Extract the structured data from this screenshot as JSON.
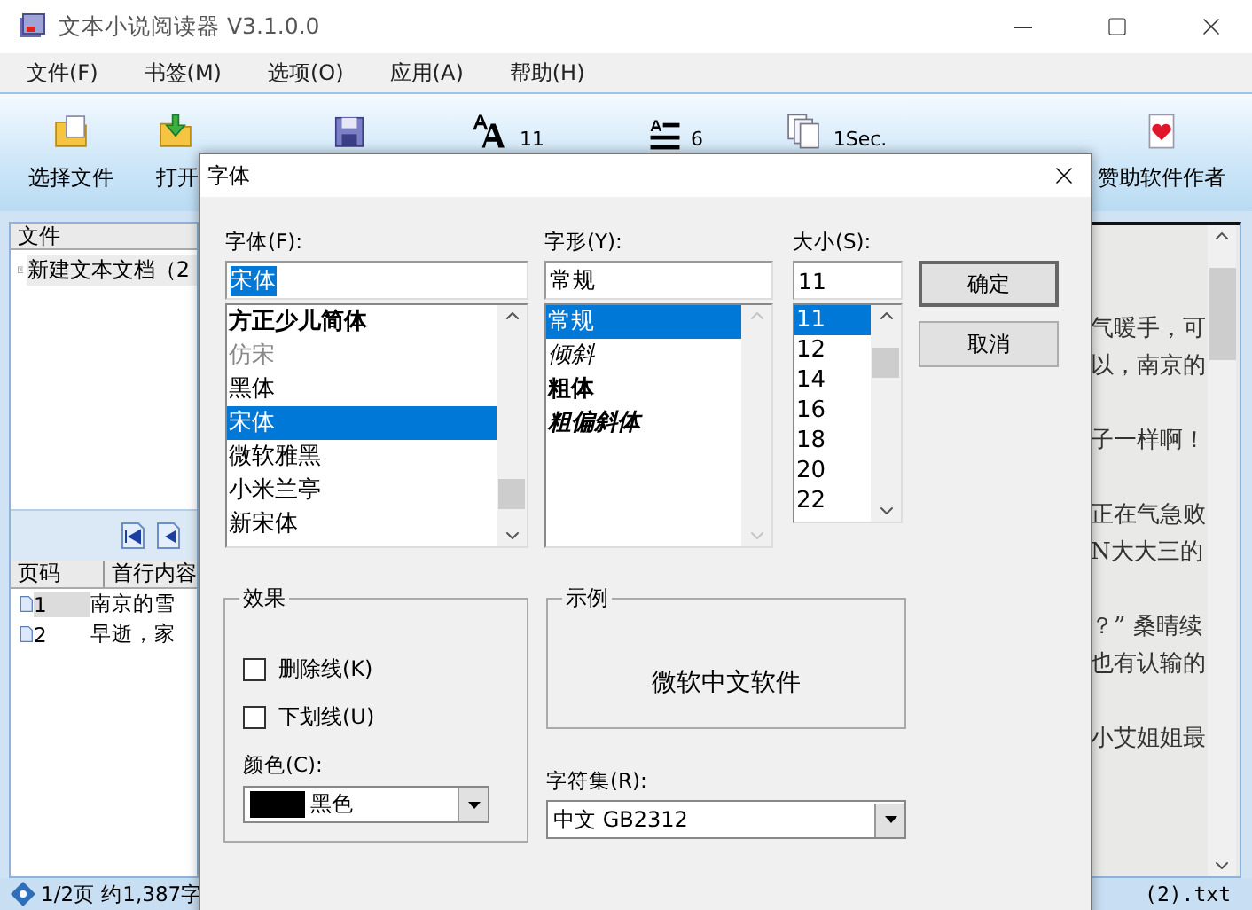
{
  "window": {
    "title": "文本小说阅读器 V3.1.0.0"
  },
  "menu": [
    "文件(F)",
    "书签(M)",
    "选项(O)",
    "应用(A)",
    "帮助(H)"
  ],
  "toolbar": [
    {
      "kind": "labeled",
      "label": "选择文件"
    },
    {
      "kind": "labeled",
      "label": "打开"
    },
    {
      "kind": "icon"
    },
    {
      "kind": "value",
      "value": "11"
    },
    {
      "kind": "value",
      "value": "6"
    },
    {
      "kind": "value",
      "value": "1Sec."
    },
    {
      "kind": "labeled",
      "label": "赞助软件作者"
    }
  ],
  "files_panel": {
    "header": "文件",
    "items": [
      {
        "name": "新建文本文档（2",
        "selected": true
      }
    ]
  },
  "pages_table": {
    "columns": [
      "页码",
      "首行内容"
    ],
    "rows": [
      {
        "page": "1",
        "first_line": "南京的雪",
        "selected": true
      },
      {
        "page": "2",
        "first_line": "早逝，家",
        "selected": false
      }
    ]
  },
  "reader": {
    "paragraphs": [
      [
        "气暖手，可",
        "以，南京的"
      ],
      [
        "子一样啊！"
      ],
      [
        "正在气急败",
        "N大大三的"
      ],
      [
        "？” 桑晴续",
        "也有认输的"
      ],
      [
        "小艾姐姐最"
      ]
    ]
  },
  "status_bar": {
    "left": "1/2页 约1,387字",
    "right": "(2).txt"
  },
  "font_dialog": {
    "title": "字体",
    "font": {
      "label": "字体(F):",
      "value": "宋体",
      "options": [
        {
          "name": "方正少儿简体",
          "kind": "bold",
          "selected": false
        },
        {
          "name": "仿宋",
          "kind": "light",
          "selected": false
        },
        {
          "name": "黑体",
          "kind": "regular",
          "selected": false
        },
        {
          "name": "宋体",
          "kind": "regular",
          "selected": true
        },
        {
          "name": "微软雅黑",
          "kind": "regular",
          "selected": false
        },
        {
          "name": "小米兰亭",
          "kind": "regular",
          "selected": false
        },
        {
          "name": "新宋体",
          "kind": "regular",
          "selected": false
        }
      ]
    },
    "style": {
      "label": "字形(Y):",
      "value": "常规",
      "options": [
        {
          "name": "常规",
          "kind": "regular",
          "selected": true
        },
        {
          "name": "倾斜",
          "kind": "italic",
          "selected": false
        },
        {
          "name": "粗体",
          "kind": "bold",
          "selected": false
        },
        {
          "name": "粗偏斜体",
          "kind": "bold-italic",
          "selected": false
        }
      ]
    },
    "size": {
      "label": "大小(S):",
      "value": "11",
      "options": [
        {
          "name": "11",
          "selected": true
        },
        {
          "name": "12",
          "selected": false
        },
        {
          "name": "14",
          "selected": false
        },
        {
          "name": "16",
          "selected": false
        },
        {
          "name": "18",
          "selected": false
        },
        {
          "name": "20",
          "selected": false
        },
        {
          "name": "22",
          "selected": false
        }
      ]
    },
    "buttons": [
      {
        "label": "确定",
        "default": true
      },
      {
        "label": "取消",
        "default": false
      }
    ],
    "effects": {
      "title": "效果",
      "options": [
        {
          "label": "删除线(K)",
          "checked": false
        },
        {
          "label": "下划线(U)",
          "checked": false
        }
      ],
      "color": {
        "label": "颜色(C):",
        "value": "黑色"
      }
    },
    "sample": {
      "title": "示例",
      "text": "微软中文软件"
    },
    "charset": {
      "label": "字符集(R):",
      "value": "中文 GB2312"
    }
  }
}
